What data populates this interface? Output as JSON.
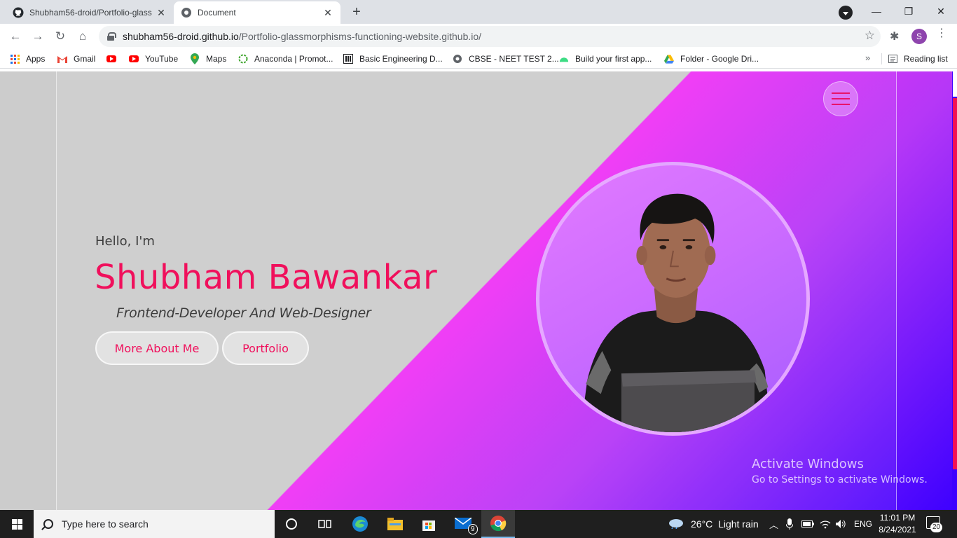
{
  "browser": {
    "tabs": [
      {
        "title": "Shubham56-droid/Portfolio-glass",
        "favicon": "github-icon",
        "active": false
      },
      {
        "title": "Document",
        "favicon": "globe-icon",
        "active": true
      }
    ],
    "url_host": "shubham56-droid.github.io",
    "url_path": "/Portfolio-glassmorphisms-functioning-website.github.io/",
    "profile_initial": "S"
  },
  "bookmarks": [
    {
      "label": "Apps",
      "icon": "apps-grid-icon"
    },
    {
      "label": "Gmail",
      "icon": "gmail-icon"
    },
    {
      "label": "",
      "icon": "youtube-icon"
    },
    {
      "label": "YouTube",
      "icon": "youtube-icon"
    },
    {
      "label": "Maps",
      "icon": "maps-pin-icon"
    },
    {
      "label": "Anaconda | Promot...",
      "icon": "anaconda-icon"
    },
    {
      "label": "Basic Engineering D...",
      "icon": "building-icon"
    },
    {
      "label": "CBSE - NEET TEST 2...",
      "icon": "globe-icon"
    },
    {
      "label": "Build your first app...",
      "icon": "android-icon"
    },
    {
      "label": "Folder - Google Dri...",
      "icon": "google-drive-icon"
    }
  ],
  "bookmarks_reading_list": "Reading list",
  "page": {
    "greeting": "Hello, I'm",
    "name": "Shubham Bawankar",
    "role": "Frontend-Developer And Web-Designer",
    "buttons": {
      "about": "More About Me",
      "portfolio": "Portfolio"
    },
    "accent_color": "#f0105c",
    "gradient_colors": [
      "#cccccc",
      "#f032f6",
      "#3d00ff"
    ]
  },
  "activation": {
    "title": "Activate Windows",
    "subtitle": "Go to Settings to activate Windows."
  },
  "taskbar": {
    "search_placeholder": "Type here to search",
    "mail_badge": "9",
    "weather_temp": "26°C",
    "weather_desc": "Light rain",
    "language": "ENG",
    "time": "11:01 PM",
    "date": "8/24/2021",
    "notifications": "20"
  }
}
